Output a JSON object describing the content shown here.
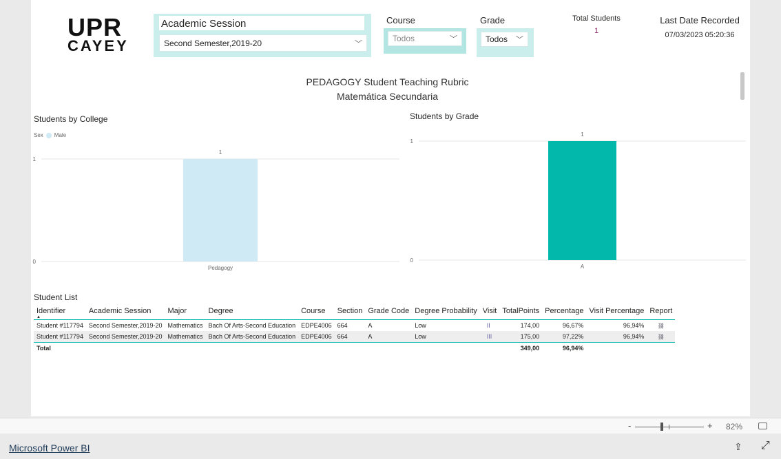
{
  "logo": {
    "line1": "UPR",
    "line2": "CAYEY"
  },
  "filters": {
    "academic_session": {
      "label": "Academic Session",
      "value": "Second Semester,2019-20"
    },
    "course": {
      "label": "Course",
      "value": "Todos"
    },
    "grade": {
      "label": "Grade",
      "value": "Todos"
    }
  },
  "kpis": {
    "total_students_label": "Total Students",
    "total_students": "1",
    "last_date_label": "Last Date Recorded",
    "last_date": "07/03/2023 05:20:36"
  },
  "title": {
    "line1": "PEDAGOGY Student Teaching Rubric",
    "line2": "Matemática Secundaria"
  },
  "chart_data": [
    {
      "type": "bar",
      "title": "Students by College",
      "legend_title": "Sex",
      "legend": [
        {
          "name": "Male",
          "color": "#cfe9f5"
        }
      ],
      "categories": [
        "Pedagogy"
      ],
      "values": [
        1
      ],
      "data_labels": [
        "1"
      ],
      "yticks": [
        "0",
        "1"
      ],
      "ylim": [
        0,
        1
      ],
      "color": "#cfe9f5",
      "grid": true
    },
    {
      "type": "bar",
      "title": "Students by Grade",
      "categories": [
        "A"
      ],
      "values": [
        1
      ],
      "data_labels": [
        "1"
      ],
      "yticks": [
        "0",
        "1"
      ],
      "ylim": [
        0,
        1
      ],
      "color": "#01b8aa",
      "grid": true
    }
  ],
  "table": {
    "title": "Student List",
    "columns": [
      "Identifier",
      "Academic Session",
      "Major",
      "Degree",
      "Course",
      "Section",
      "Grade Code",
      "Degree Probability",
      "Visit",
      "TotalPoints",
      "Percentage",
      "Visit Percentage",
      "Report"
    ],
    "rows": [
      [
        "Student #117794",
        "Second Semester,2019-20",
        "Mathematics",
        "Bach Of Arts-Second Education",
        "EDPE4006",
        "664",
        "A",
        "Low",
        "II",
        "174,00",
        "96,67%",
        "96,94%"
      ],
      [
        "Student #117794",
        "Second Semester,2019-20",
        "Mathematics",
        "Bach Of Arts-Second Education",
        "EDPE4006",
        "664",
        "A",
        "Low",
        "III",
        "175,00",
        "97,22%",
        "96,94%"
      ]
    ],
    "total": {
      "label": "Total",
      "total_points": "349,00",
      "percentage": "96,94%"
    },
    "sort_column": "Identifier",
    "report_icon": "link-icon"
  },
  "zoom": {
    "minus": "-",
    "plus": "+",
    "level": "82%",
    "level_fraction": 0.82
  },
  "footer": {
    "brand": "Microsoft Power BI"
  }
}
